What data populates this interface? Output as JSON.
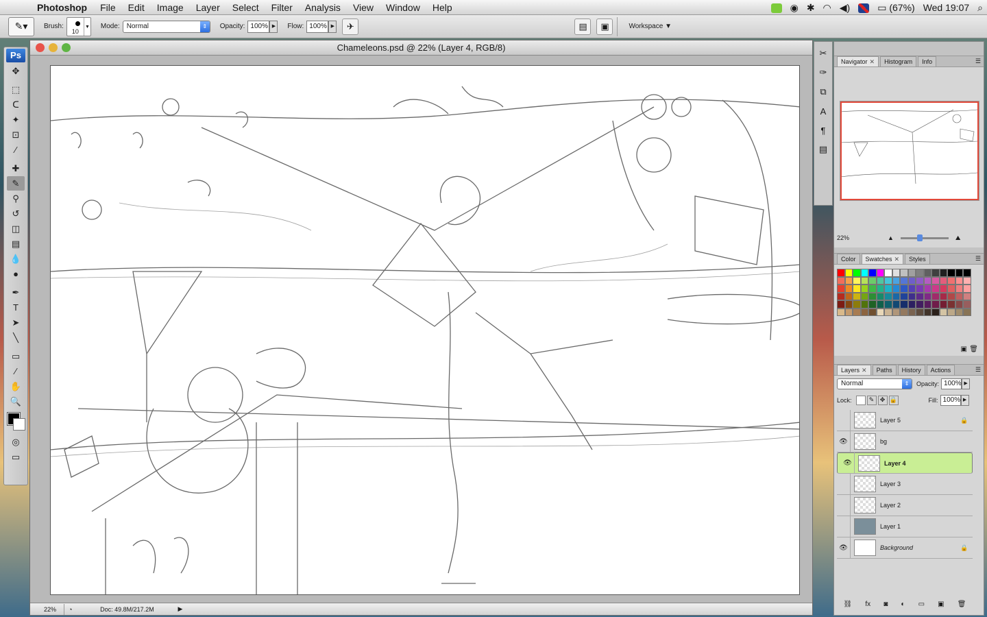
{
  "menubar": {
    "app_name": "Photoshop",
    "items": [
      "File",
      "Edit",
      "Image",
      "Layer",
      "Select",
      "Filter",
      "Analysis",
      "View",
      "Window",
      "Help"
    ],
    "battery": "(67%)",
    "clock": "Wed 19:07"
  },
  "options": {
    "brush_label": "Brush:",
    "brush_size": "10",
    "mode_label": "Mode:",
    "mode_value": "Normal",
    "opacity_label": "Opacity:",
    "opacity_value": "100%",
    "flow_label": "Flow:",
    "flow_value": "100%",
    "workspace_label": "Workspace"
  },
  "toolbox": {
    "logo": "Ps",
    "tools": [
      {
        "name": "move-tool",
        "glyph": "✥"
      },
      {
        "name": "marquee-tool",
        "glyph": "⬚"
      },
      {
        "name": "lasso-tool",
        "glyph": "ᑕ"
      },
      {
        "name": "magic-wand-tool",
        "glyph": "✦"
      },
      {
        "name": "crop-tool",
        "glyph": "⊡"
      },
      {
        "name": "eyedropper-tool",
        "glyph": "⁄"
      },
      {
        "name": "healing-brush-tool",
        "glyph": "✚"
      },
      {
        "name": "brush-tool",
        "glyph": "✎"
      },
      {
        "name": "clone-stamp-tool",
        "glyph": "⚲"
      },
      {
        "name": "history-brush-tool",
        "glyph": "↺"
      },
      {
        "name": "eraser-tool",
        "glyph": "◫"
      },
      {
        "name": "gradient-tool",
        "glyph": "▤"
      },
      {
        "name": "blur-tool",
        "glyph": "💧"
      },
      {
        "name": "dodge-tool",
        "glyph": "●"
      },
      {
        "name": "pen-tool",
        "glyph": "✒"
      },
      {
        "name": "type-tool",
        "glyph": "T"
      },
      {
        "name": "path-selection-tool",
        "glyph": "➤"
      },
      {
        "name": "line-tool",
        "glyph": "╲"
      },
      {
        "name": "notes-tool",
        "glyph": "▭"
      },
      {
        "name": "color-sampler-tool",
        "glyph": "⁄"
      },
      {
        "name": "hand-tool",
        "glyph": "✋"
      },
      {
        "name": "zoom-tool",
        "glyph": "🔍"
      }
    ]
  },
  "document": {
    "title": "Chameleons.psd @ 22% (Layer 4, RGB/8)",
    "zoom": "22%",
    "doc_info": "Doc: 49.8M/217.2M"
  },
  "navigator": {
    "tabs": [
      "Navigator",
      "Histogram",
      "Info"
    ],
    "zoom": "22%"
  },
  "color_panel": {
    "tabs": [
      "Color",
      "Swatches",
      "Styles"
    ],
    "swatches": [
      "#ff0000",
      "#ffff00",
      "#00ff00",
      "#00ffff",
      "#0000ff",
      "#ff00ff",
      "#ffffff",
      "#e0e0e0",
      "#c0c0c0",
      "#a0a0a0",
      "#808080",
      "#606060",
      "#404040",
      "#202020",
      "#000000",
      "#000000",
      "#000000",
      "#f26d5b",
      "#f7a14a",
      "#fff45c",
      "#b6e05a",
      "#6ccb6a",
      "#4fc6a0",
      "#46c6d9",
      "#4aa3e2",
      "#5476d6",
      "#6f5fc9",
      "#8e5cc7",
      "#b45cc2",
      "#d85ba3",
      "#e35d7c",
      "#f07070",
      "#ff9090",
      "#ffb0b0",
      "#e6402e",
      "#f08a24",
      "#ffe620",
      "#9ad21e",
      "#3fb848",
      "#22b38a",
      "#1eb3c9",
      "#2589d6",
      "#2e59c4",
      "#5540b5",
      "#7a3bb3",
      "#a63aae",
      "#cc3a8a",
      "#d63a5f",
      "#e06060",
      "#f08080",
      "#ffa0a0",
      "#b52b1e",
      "#c0671a",
      "#cbb312",
      "#75a512",
      "#2d8e35",
      "#178a6a",
      "#168a9c",
      "#1a68a6",
      "#20439a",
      "#3f2f8c",
      "#5e2b8a",
      "#802a86",
      "#a02a6a",
      "#a62a48",
      "#b04848",
      "#c06060",
      "#d08080",
      "#7c1c13",
      "#854711",
      "#8c7c0c",
      "#51730c",
      "#1f6224",
      "#10604a",
      "#0f606c",
      "#124873",
      "#162e6b",
      "#2c2061",
      "#411e60",
      "#591d5e",
      "#701d4a",
      "#741d32",
      "#7a3232",
      "#884848",
      "#985e5e",
      "#d9b98a",
      "#c49a6c",
      "#a87c52",
      "#8c6440",
      "#704f30",
      "#e8d7b8",
      "#cbb494",
      "#b0967a",
      "#94795f",
      "#7a6350",
      "#5e4c3e",
      "#42342a",
      "#2a201a",
      "#d4c4a4",
      "#bca888",
      "#a08c6c",
      "#887456"
    ]
  },
  "layers_panel": {
    "tabs": [
      "Layers",
      "Paths",
      "History",
      "Actions"
    ],
    "blend_mode": "Normal",
    "opacity_label": "Opacity:",
    "opacity_value": "100%",
    "lock_label": "Lock:",
    "fill_label": "Fill:",
    "fill_value": "100%",
    "layers": [
      {
        "name": "Layer 5",
        "visible": false,
        "locked": true,
        "selected": false
      },
      {
        "name": "bg",
        "visible": true,
        "locked": false,
        "selected": false
      },
      {
        "name": "Layer 4",
        "visible": true,
        "locked": false,
        "selected": true
      },
      {
        "name": "Layer 3",
        "visible": false,
        "locked": false,
        "selected": false
      },
      {
        "name": "Layer 2",
        "visible": false,
        "locked": false,
        "selected": false
      },
      {
        "name": "Layer 1",
        "visible": false,
        "locked": false,
        "selected": false
      },
      {
        "name": "Background",
        "visible": true,
        "locked": true,
        "selected": false
      }
    ]
  },
  "colors": {
    "selected_layer": "#c9ee95",
    "navigator_box": "#e2493a",
    "accent": "#2d6fe0"
  }
}
